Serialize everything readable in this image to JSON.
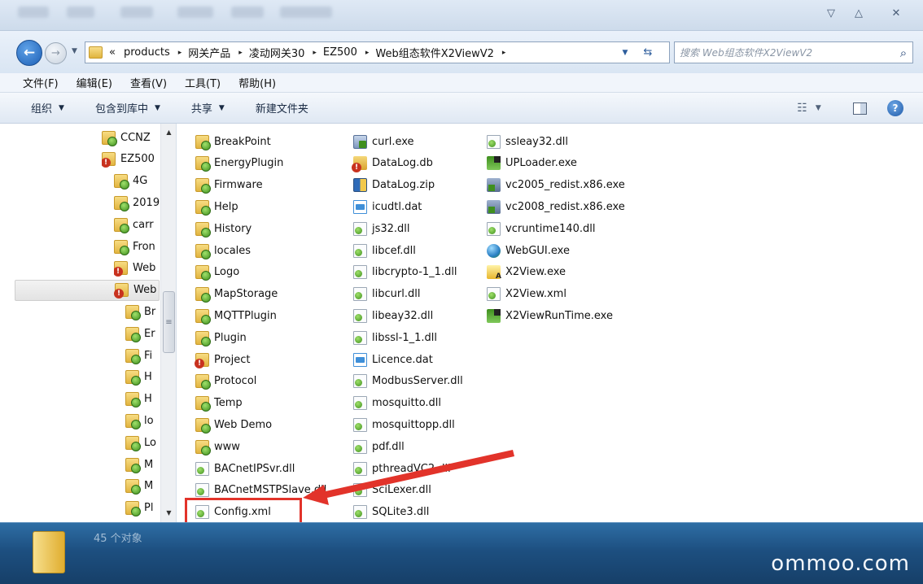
{
  "window": {
    "controls": {
      "minimize": "▽",
      "maximize": "△",
      "close": "✕"
    }
  },
  "address": {
    "overflow": "«",
    "crumbs": [
      "products",
      "网关产品",
      "凌动网关30",
      "EZ500",
      "Web组态软件X2ViewV2"
    ],
    "separator": "▸",
    "refresh_icon": "refresh-icon"
  },
  "search": {
    "placeholder": "搜索 Web组态软件X2ViewV2"
  },
  "menu": [
    "文件(F)",
    "编辑(E)",
    "查看(V)",
    "工具(T)",
    "帮助(H)"
  ],
  "commands": {
    "organize": "组织",
    "include_library": "包含到库中",
    "share": "共享",
    "new_folder": "新建文件夹"
  },
  "nav": {
    "items": [
      {
        "label": "CCNZ",
        "icon": "folder",
        "indent": 1
      },
      {
        "label": "EZ500",
        "icon": "locked-folder",
        "indent": 1
      },
      {
        "label": "4G",
        "icon": "folder",
        "indent": 2
      },
      {
        "label": "2019",
        "icon": "folder",
        "indent": 2
      },
      {
        "label": "carr",
        "icon": "folder",
        "indent": 2
      },
      {
        "label": "Fron",
        "icon": "folder",
        "indent": 2
      },
      {
        "label": "Web",
        "icon": "locked-folder",
        "indent": 2
      },
      {
        "label": "Web",
        "icon": "locked-folder",
        "indent": 2,
        "selected": true
      },
      {
        "label": "Br",
        "icon": "folder",
        "indent": 3
      },
      {
        "label": "Er",
        "icon": "folder",
        "indent": 3
      },
      {
        "label": "Fi",
        "icon": "folder",
        "indent": 3
      },
      {
        "label": "H",
        "icon": "folder",
        "indent": 3
      },
      {
        "label": "H",
        "icon": "folder",
        "indent": 3
      },
      {
        "label": "lo",
        "icon": "folder",
        "indent": 3
      },
      {
        "label": "Lo",
        "icon": "folder",
        "indent": 3
      },
      {
        "label": "M",
        "icon": "folder",
        "indent": 3
      },
      {
        "label": "M",
        "icon": "folder",
        "indent": 3
      },
      {
        "label": "Pl",
        "icon": "folder",
        "indent": 3
      }
    ]
  },
  "files": {
    "columns": [
      [
        {
          "name": "BreakPoint",
          "icon": "folder"
        },
        {
          "name": "EnergyPlugin",
          "icon": "folder"
        },
        {
          "name": "Firmware",
          "icon": "folder"
        },
        {
          "name": "Help",
          "icon": "folder"
        },
        {
          "name": "History",
          "icon": "folder"
        },
        {
          "name": "locales",
          "icon": "folder"
        },
        {
          "name": "Logo",
          "icon": "folder"
        },
        {
          "name": "MapStorage",
          "icon": "folder"
        },
        {
          "name": "MQTTPlugin",
          "icon": "folder"
        },
        {
          "name": "Plugin",
          "icon": "folder"
        },
        {
          "name": "Project",
          "icon": "locked-folder"
        },
        {
          "name": "Protocol",
          "icon": "folder"
        },
        {
          "name": "Temp",
          "icon": "folder"
        },
        {
          "name": "Web Demo",
          "icon": "folder"
        },
        {
          "name": "www",
          "icon": "folder"
        },
        {
          "name": "BACnetIPSvr.dll",
          "icon": "file"
        },
        {
          "name": "BACnetMSTPSlave.dll",
          "icon": "file"
        },
        {
          "name": "Config.xml",
          "icon": "file",
          "highlighted": true
        }
      ],
      [
        {
          "name": "curl.exe",
          "icon": "exe"
        },
        {
          "name": "DataLog.db",
          "icon": "db"
        },
        {
          "name": "DataLog.zip",
          "icon": "zip"
        },
        {
          "name": "icudtl.dat",
          "icon": "dat"
        },
        {
          "name": "js32.dll",
          "icon": "file"
        },
        {
          "name": "libcef.dll",
          "icon": "file"
        },
        {
          "name": "libcrypto-1_1.dll",
          "icon": "file"
        },
        {
          "name": "libcurl.dll",
          "icon": "file"
        },
        {
          "name": "libeay32.dll",
          "icon": "file"
        },
        {
          "name": "libssl-1_1.dll",
          "icon": "file"
        },
        {
          "name": "Licence.dat",
          "icon": "dat"
        },
        {
          "name": "ModbusServer.dll",
          "icon": "file"
        },
        {
          "name": "mosquitto.dll",
          "icon": "file"
        },
        {
          "name": "mosquittopp.dll",
          "icon": "file"
        },
        {
          "name": "pdf.dll",
          "icon": "file"
        },
        {
          "name": "pthreadVC2.dll",
          "icon": "file"
        },
        {
          "name": "SciLexer.dll",
          "icon": "file"
        },
        {
          "name": "SQLite3.dll",
          "icon": "file"
        }
      ],
      [
        {
          "name": "ssleay32.dll",
          "icon": "file"
        },
        {
          "name": "UPLoader.exe",
          "icon": "runtime"
        },
        {
          "name": "vc2005_redist.x86.exe",
          "icon": "installer"
        },
        {
          "name": "vc2008_redist.x86.exe",
          "icon": "installer"
        },
        {
          "name": "vcruntime140.dll",
          "icon": "file"
        },
        {
          "name": "WebGUI.exe",
          "icon": "globe"
        },
        {
          "name": "X2View.exe",
          "icon": "x2"
        },
        {
          "name": "X2View.xml",
          "icon": "file"
        },
        {
          "name": "X2ViewRunTime.exe",
          "icon": "runtime"
        }
      ]
    ]
  },
  "details": {
    "count": "45 个对象",
    "watermark": "ommoo.com"
  },
  "colors": {
    "highlight": "#e2332a",
    "details_bg": "#1d4f80"
  }
}
